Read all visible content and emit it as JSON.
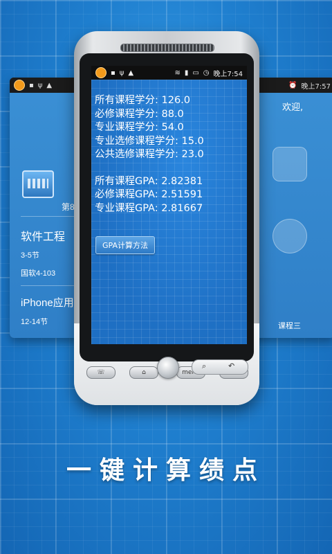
{
  "main_phone": {
    "status_bar": {
      "time": "晚上7:54",
      "icons": [
        "app-icon",
        "sim-icon",
        "usb-icon",
        "android-debug-icon",
        "wifi-icon",
        "signal-icon",
        "battery-icon",
        "alarm-icon"
      ]
    },
    "credits": [
      "所有课程学分: 126.0",
      "必修课程学分: 88.0",
      "专业课程学分: 54.0",
      "专业选修课程学分: 15.0",
      "公共选修课程学分: 23.0"
    ],
    "gpas": [
      "所有课程GPA: 2.82381",
      "必修课程GPA: 2.51591",
      "专业课程GPA: 2.81667"
    ],
    "gpa_method_button": "GPA计算方法",
    "hardware_buttons": {
      "menu_label": "menu"
    }
  },
  "left_phone": {
    "status_time": "",
    "week_label": "第8",
    "courses": [
      {
        "name": "软件工程",
        "time": "3-5节",
        "room": "国软4-103"
      },
      {
        "name": "iPhone应用",
        "time": "12-14节"
      }
    ]
  },
  "right_phone": {
    "status_time": "晚上7:57",
    "greeting": "欢迎,",
    "bottom_label": "课程三"
  },
  "caption": "一键计算绩点",
  "colors": {
    "background": "#1f7fcf",
    "screen": "#1e6fc3",
    "text": "#ffffff",
    "accent": "#f39a1b"
  }
}
